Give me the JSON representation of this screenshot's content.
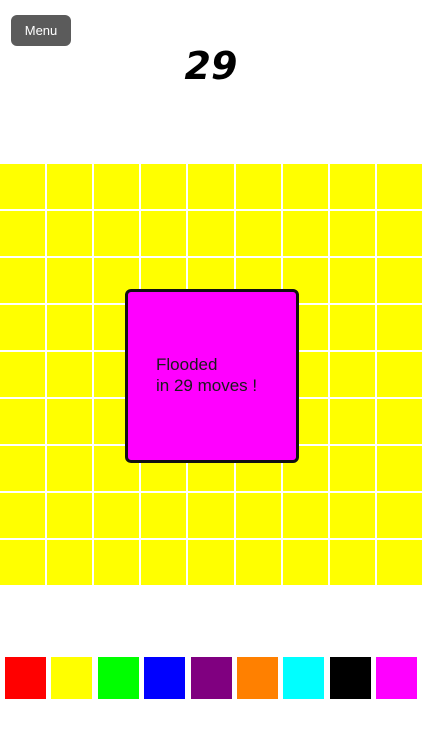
{
  "menu": {
    "label": "Menu"
  },
  "moves": "29",
  "board": {
    "rows": 9,
    "cols": 9,
    "fill_color": "#ffff00"
  },
  "dialog": {
    "line1": "Flooded",
    "line2": "in 29 moves !",
    "color": "#ff00ff"
  },
  "palette": [
    {
      "name": "red",
      "color": "#ff0000"
    },
    {
      "name": "yellow",
      "color": "#ffff00"
    },
    {
      "name": "green",
      "color": "#00ff00"
    },
    {
      "name": "blue",
      "color": "#0000ff"
    },
    {
      "name": "purple",
      "color": "#800080"
    },
    {
      "name": "orange",
      "color": "#ff8000"
    },
    {
      "name": "cyan",
      "color": "#00ffff"
    },
    {
      "name": "black",
      "color": "#000000"
    },
    {
      "name": "magenta",
      "color": "#ff00ff"
    }
  ]
}
